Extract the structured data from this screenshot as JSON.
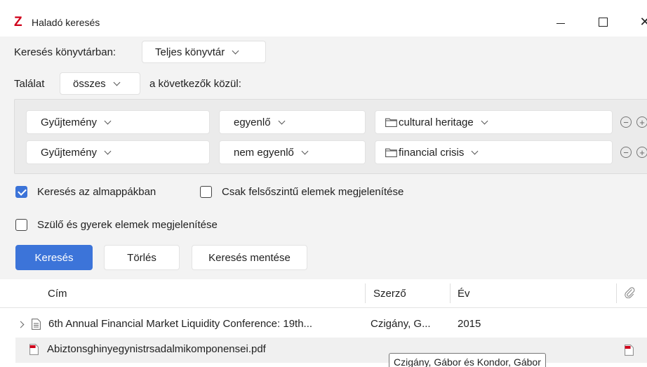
{
  "window": {
    "app_logo": "Z",
    "title": "Haladó keresés",
    "close_glyph": "✕"
  },
  "scope": {
    "label": "Keresés könyvtárban:",
    "library_value": "Teljes könyvtár"
  },
  "match": {
    "label": "Találat",
    "mode_value": "összes",
    "suffix": "a következők közül:"
  },
  "conditions": [
    {
      "field": "Gyűjtemény",
      "operator": "egyenlő",
      "value": "cultural heritage",
      "value_icon": "folder-icon"
    },
    {
      "field": "Gyűjtemény",
      "operator": "nem egyenlő",
      "value": "financial crisis",
      "value_icon": "folder-icon"
    }
  ],
  "condition_buttons": {
    "remove": "−",
    "add": "+"
  },
  "options": {
    "subcollections": {
      "label": "Keresés az almappákban",
      "checked": true
    },
    "top_level_only": {
      "label": "Csak felsőszintű elemek megjelenítése",
      "checked": false
    },
    "parent_child": {
      "label": "Szülő és gyerek elemek megjelenítése",
      "checked": false
    }
  },
  "buttons": {
    "search": "Keresés",
    "clear": "Törlés",
    "save_search": "Keresés mentése"
  },
  "results": {
    "columns": {
      "title": "Cím",
      "creator": "Szerző",
      "year": "Év",
      "attachments_icon": "paperclip-icon"
    },
    "rows": [
      {
        "title": "6th Annual Financial Market Liquidity Conference: 19th...",
        "creator": "Czigány, G...",
        "year": "2015",
        "icon": "document-icon",
        "expandable": true
      },
      {
        "title": "Abiztonsghinyegynistrsadalmikomponensei.pdf",
        "creator": "",
        "year": "",
        "icon": "pdf-icon",
        "attachment_icon": "pdf-icon"
      }
    ]
  },
  "tooltip": "Czigány, Gábor és Kondor, Gábor",
  "colors": {
    "accent": "#3c74d9",
    "logo": "#d0021b",
    "pdf": "#d0021b"
  }
}
